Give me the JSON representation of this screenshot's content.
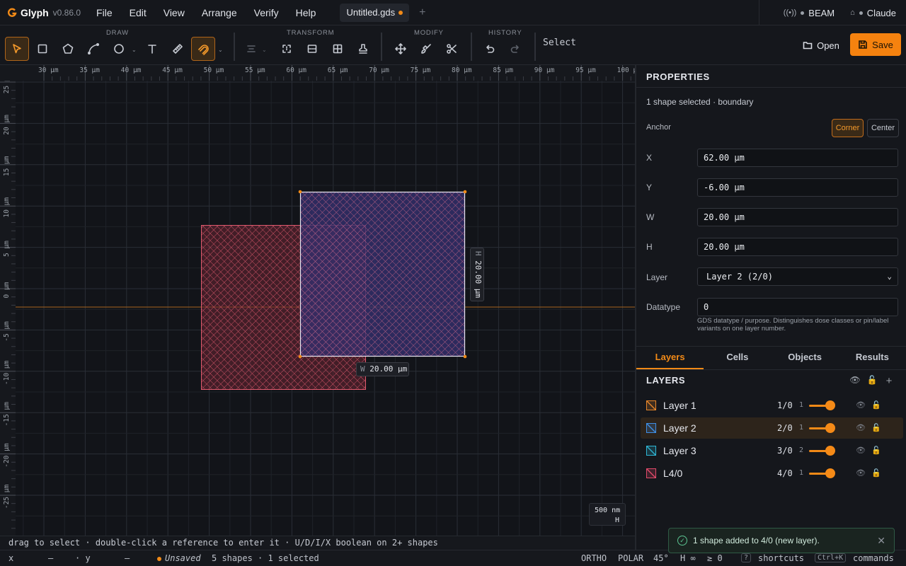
{
  "app": {
    "name": "Glyph",
    "version": "v0.86.0"
  },
  "menu": {
    "items": [
      "File",
      "Edit",
      "View",
      "Arrange",
      "Verify",
      "Help"
    ]
  },
  "document_tab": {
    "title": "Untitled.gds",
    "unsaved": true
  },
  "menu_right": {
    "beam_label": "BEAM",
    "user_label": "Claude"
  },
  "toolbar": {
    "groups": {
      "draw": "DRAW",
      "transform": "TRANSFORM",
      "modify": "MODIFY",
      "history": "HISTORY"
    },
    "tools": [
      "select-tool",
      "rectangle-tool",
      "polygon-tool",
      "path-tool",
      "circle-tool",
      "text-tool",
      "ruler-tool",
      "snap-tool",
      "align-tool",
      "flip-horizontal-tool",
      "flip-vertical-tool",
      "array-tool",
      "anchor-tool",
      "move-tool",
      "brush-tool",
      "cut-tool",
      "undo",
      "redo"
    ],
    "current_tool": "Select",
    "open_label": "Open",
    "save_label": "Save"
  },
  "canvas": {
    "x_ruler": [
      "30 µm",
      "35 µm",
      "40 µm",
      "45 µm",
      "50 µm",
      "55 µm",
      "60 µm",
      "65 µm",
      "70 µm",
      "75 µm",
      "80 µm",
      "85 µm",
      "90 µm",
      "95 µm",
      "100 µ"
    ],
    "y_ruler": [
      "25 µm",
      "20 µm",
      "15 µm",
      "10 µm",
      "5 µm",
      "0 µm",
      "-5 µm",
      "-10 µm",
      "-15 µm",
      "-20 µm",
      "-25 µm"
    ],
    "height_badge": "20.00 µm",
    "height_badge_prefix": "H",
    "width_badge": "20.00 µm",
    "width_badge_prefix": "W",
    "scale_value": "500 nm",
    "scale_sub": "H"
  },
  "hint": "drag to select · double-click a reference to enter it · U/D/I/X boolean on 2+ shapes",
  "status": {
    "x_label": "x",
    "x_value": "—",
    "y_label": "· y",
    "y_value": "—",
    "unsaved": "Unsaved",
    "selection": "5 shapes · 1 selected",
    "ortho": "ORTHO",
    "polar": "POLAR",
    "angle": "45°",
    "h_val": "H ∞",
    "ge": "≥ 0",
    "shortcuts_key": "?",
    "shortcuts_label": "shortcuts",
    "commands_key": "Ctrl+K",
    "commands_label": "commands"
  },
  "properties": {
    "title": "PROPERTIES",
    "summary": "1 shape selected · boundary",
    "anchor_label": "Anchor",
    "anchor_options": [
      "Corner",
      "Center"
    ],
    "x_label": "X",
    "x_value": "62.00 µm",
    "y_label": "Y",
    "y_value": "-6.00 µm",
    "w_label": "W",
    "w_value": "20.00 µm",
    "h_label": "H",
    "h_value": "20.00 µm",
    "layer_label": "Layer",
    "layer_value": "Layer 2 (2/0)",
    "datatype_label": "Datatype",
    "datatype_value": "0",
    "datatype_help": "GDS datatype / purpose. Distinguishes dose classes or pin/label variants on one layer number."
  },
  "panel_tabs": [
    "Layers",
    "Cells",
    "Objects",
    "Results"
  ],
  "layers": {
    "title": "LAYERS",
    "items": [
      {
        "name": "Layer 1",
        "num": "1/0",
        "count": "1",
        "color": "#e8862a"
      },
      {
        "name": "Layer 2",
        "num": "2/0",
        "count": "1",
        "color": "#3f8fe6"
      },
      {
        "name": "Layer 3",
        "num": "3/0",
        "count": "2",
        "color": "#2fb7d6"
      },
      {
        "name": "L4/0",
        "num": "4/0",
        "count": "1",
        "color": "#e34a6b"
      }
    ]
  },
  "toast": {
    "message": "1 shape added to 4/0 (new layer)."
  }
}
